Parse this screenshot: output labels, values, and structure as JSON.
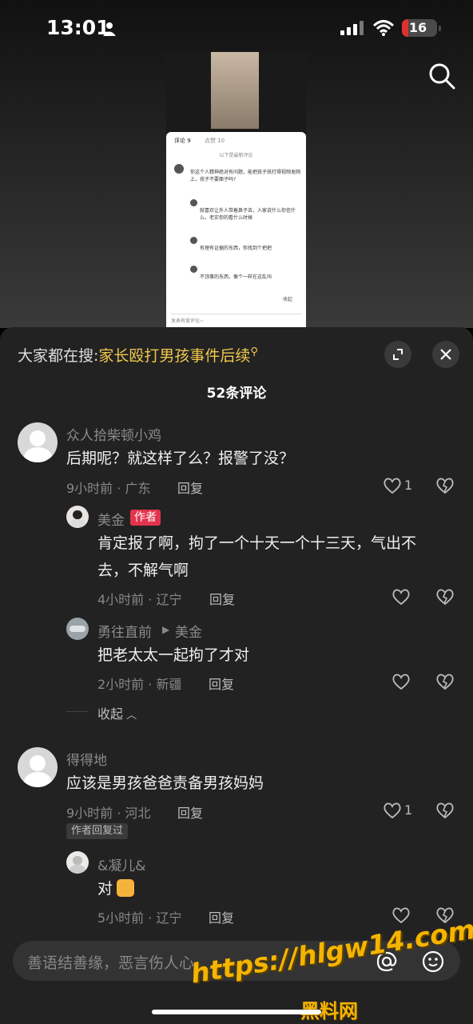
{
  "status_bar": {
    "time": "13:01",
    "battery": "16"
  },
  "thumbnail": {
    "tabs": [
      "评论 9",
      "点赞 10"
    ],
    "notice": "以下是最新评论",
    "comment1": "你这个人精神绝对有问题，能把孩子孩打得视频发网上，孩子不要面子吗?",
    "reply1": "就喜欢让外人带着鼻子去，人家说什么你信什么，老实你的看什么时候",
    "reply2": "有理有证据的东西，你找到个把把",
    "reply3": "不顶事的东西，像个一样在这乱叫",
    "collapse": "收起",
    "input_placeholder": "发表有爱评论~"
  },
  "sheet": {
    "hot_search_label": "大家都在搜:",
    "hot_search_keyword": "家长殴打男孩事件后续",
    "comment_count": "52条评论",
    "reply_label": "回复",
    "author_tag": "作者",
    "collapse_label": "收起",
    "author_replied_label": "作者回复过",
    "comments": [
      {
        "user": "众人拾柴顿小鸡",
        "text": "后期呢？就这样了么？报警了没？",
        "meta": "9小时前 · 广东",
        "likes": "1"
      },
      {
        "user": "美金",
        "text1": "肯定报了啊，拘了一个十天一个十三天，气出不",
        "text2": "去，不解气啊",
        "meta": "4小时前 · 辽宁"
      },
      {
        "user": "勇往直前",
        "reply_to": "美金",
        "text": "把老太太一起拘了才对",
        "meta": "2小时前 · 新疆"
      },
      {
        "user": "得得地",
        "text": "应该是男孩爸爸责备男孩妈妈",
        "meta": "9小时前 · 河北",
        "likes": "1"
      },
      {
        "user": "&凝儿&",
        "text": "对",
        "meta": "5小时前 · 辽宁"
      }
    ]
  },
  "input": {
    "placeholder": "善语结善缘，恶言伤人心"
  },
  "watermark": {
    "url": "https://hlgw14.com",
    "name": "黑料网"
  },
  "colors": {
    "background": "#222222",
    "accent_red": "#e4344d",
    "hot_keyword": "#f2c94c",
    "watermark": "#f5b400"
  }
}
